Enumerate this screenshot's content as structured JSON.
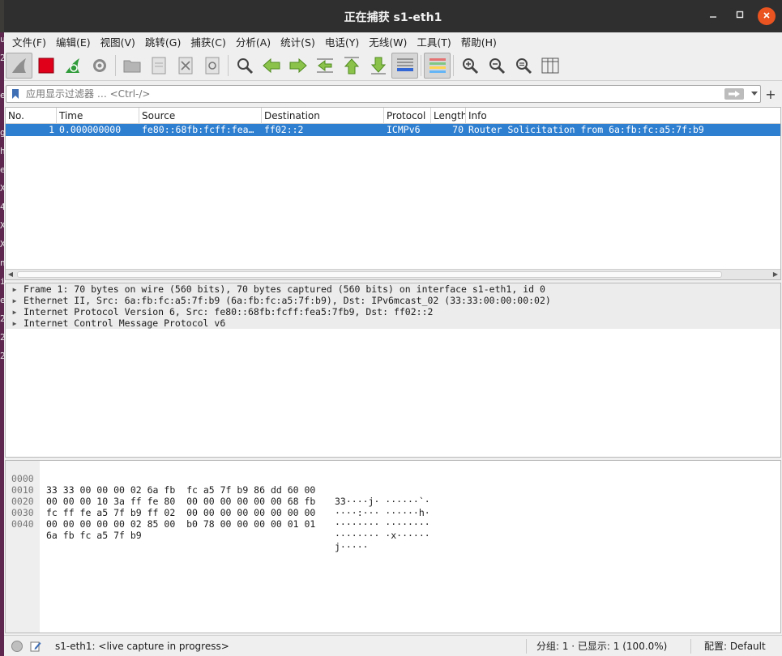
{
  "window": {
    "title": "正在捕获 s1-eth1"
  },
  "desktop_glyphs": [
    "u",
    "2",
    "",
    "e",
    "",
    "g",
    "h",
    "e",
    "X",
    "4",
    "X",
    "X",
    "n",
    "i",
    "e",
    "2",
    "2",
    "2"
  ],
  "menu": [
    "文件(F)",
    "编辑(E)",
    "视图(V)",
    "跳转(G)",
    "捕获(C)",
    "分析(A)",
    "统计(S)",
    "电话(Y)",
    "无线(W)",
    "工具(T)",
    "帮助(H)"
  ],
  "filter": {
    "placeholder": "应用显示过滤器 … <Ctrl-/>"
  },
  "packet_list": {
    "columns": [
      "No.",
      "Time",
      "Source",
      "Destination",
      "Protocol",
      "Length",
      "Info"
    ],
    "rows": [
      {
        "no": "1",
        "time": "0.000000000",
        "source": "fe80::68fb:fcff:fea…",
        "destination": "ff02::2",
        "protocol": "ICMPv6",
        "length": "70",
        "info": "Router Solicitation from 6a:fb:fc:a5:7f:b9"
      }
    ]
  },
  "details": [
    "Frame 1: 70 bytes on wire (560 bits), 70 bytes captured (560 bits) on interface s1-eth1, id 0",
    "Ethernet II, Src: 6a:fb:fc:a5:7f:b9 (6a:fb:fc:a5:7f:b9), Dst: IPv6mcast_02 (33:33:00:00:00:02)",
    "Internet Protocol Version 6, Src: fe80::68fb:fcff:fea5:7fb9, Dst: ff02::2",
    "Internet Control Message Protocol v6"
  ],
  "bytes": [
    {
      "offset": "0000",
      "hex": "33 33 00 00 00 02 6a fb  fc a5 7f b9 86 dd 60 00",
      "ascii": "33····j· ······`·"
    },
    {
      "offset": "0010",
      "hex": "00 00 00 10 3a ff fe 80  00 00 00 00 00 00 68 fb",
      "ascii": "····:··· ······h·"
    },
    {
      "offset": "0020",
      "hex": "fc ff fe a5 7f b9 ff 02  00 00 00 00 00 00 00 00",
      "ascii": "········ ········"
    },
    {
      "offset": "0030",
      "hex": "00 00 00 00 00 02 85 00  b0 78 00 00 00 00 01 01",
      "ascii": "········ ·x······"
    },
    {
      "offset": "0040",
      "hex": "6a fb fc a5 7f b9",
      "ascii": "j·····"
    }
  ],
  "status": {
    "capture": "s1-eth1: <live capture in progress>",
    "packets": "分组: 1 · 已显示: 1 (100.0%)",
    "profile": "配置: Default"
  }
}
